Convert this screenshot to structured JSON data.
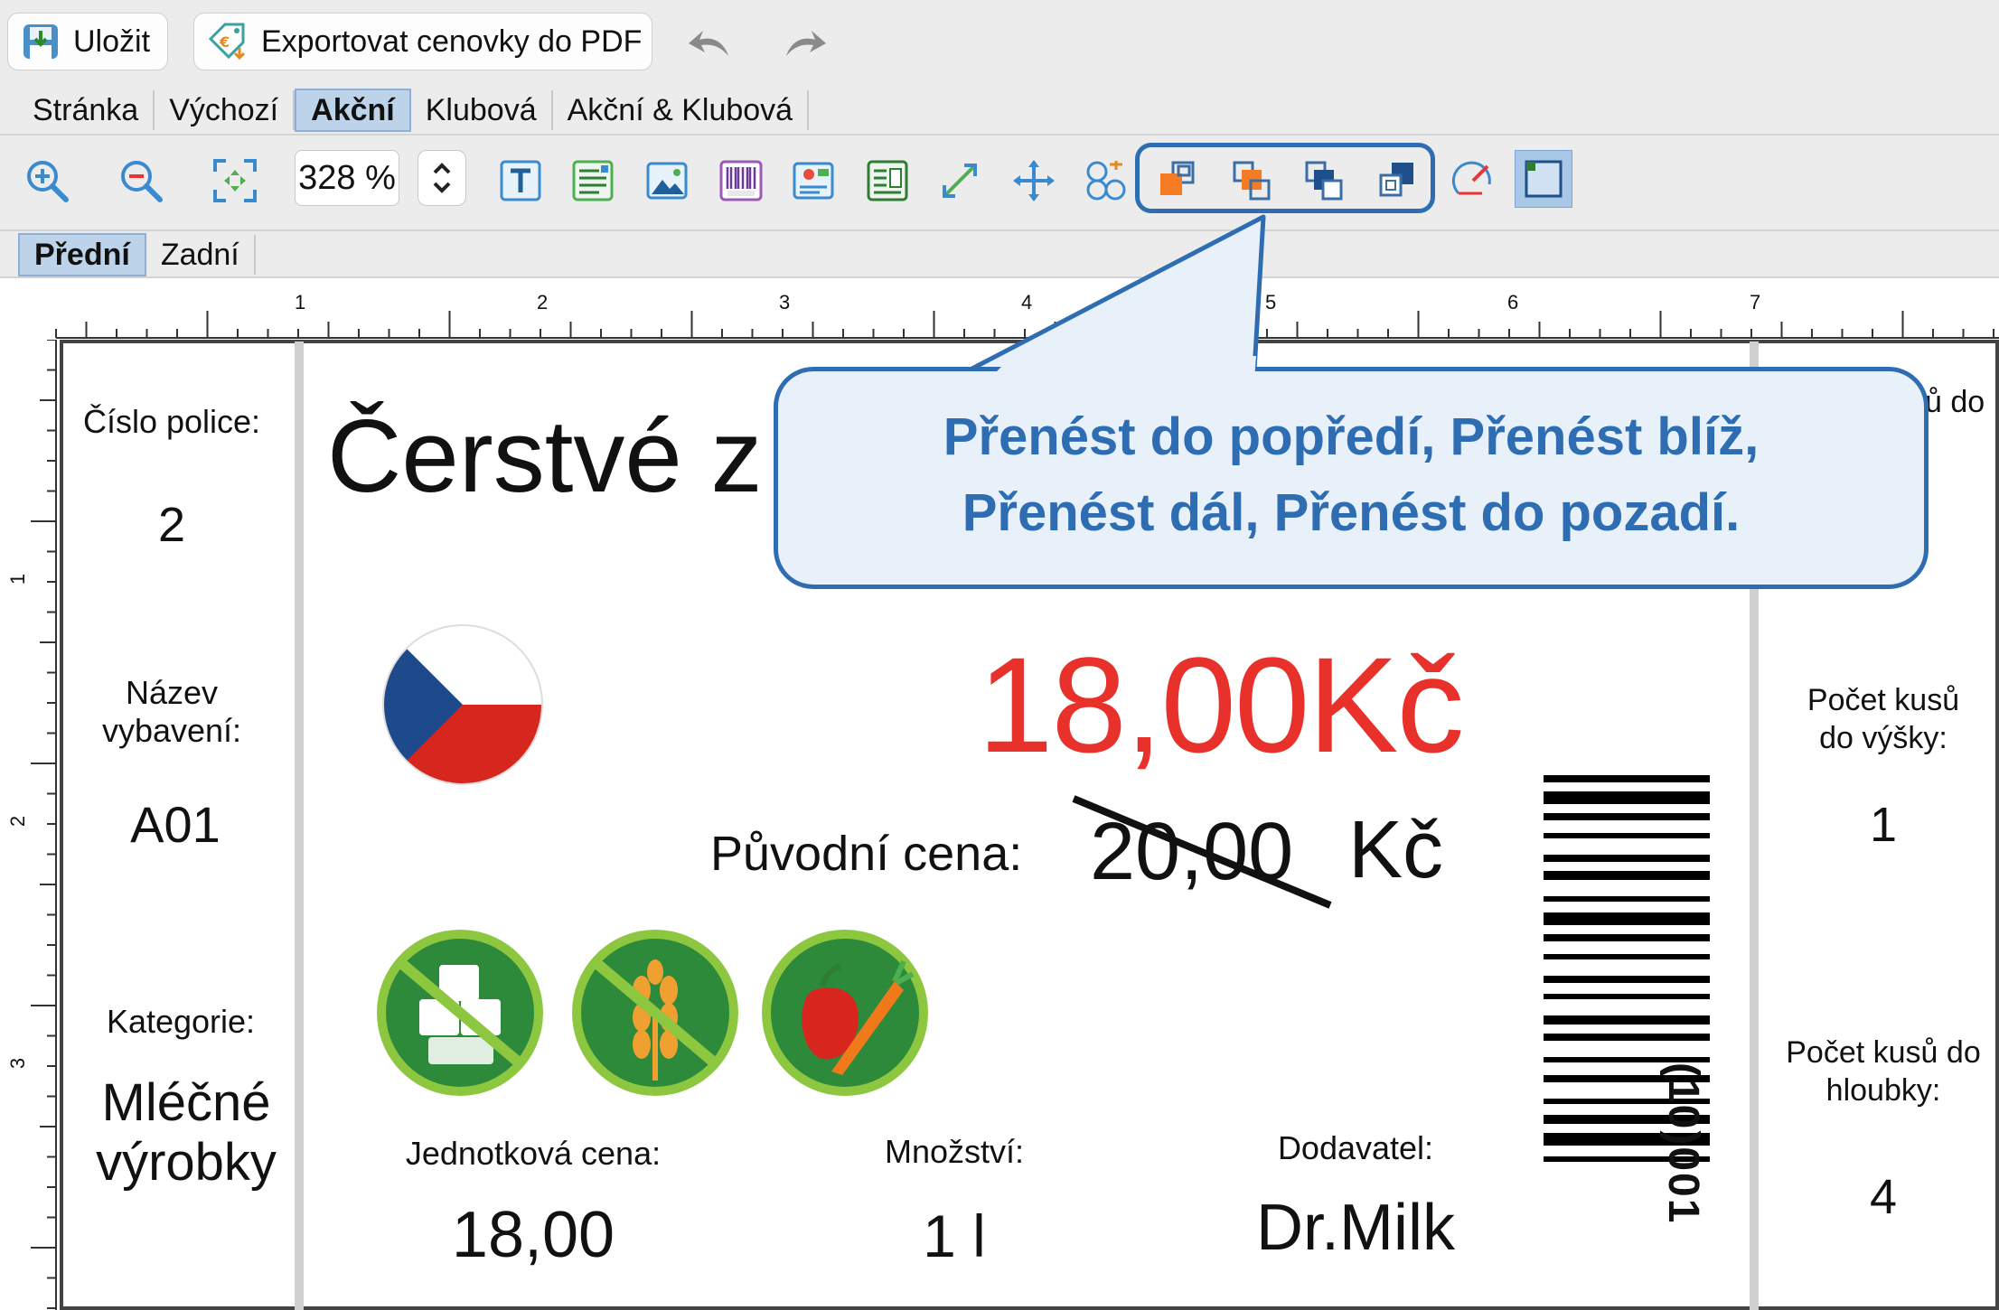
{
  "toolbar": {
    "save_label": "Uložit",
    "export_label": "Exportovat cenovky do PDF"
  },
  "tabs": [
    "Stránka",
    "Výchozí",
    "Akční",
    "Klubová",
    "Akční & Klubová"
  ],
  "active_tab": "Akční",
  "zoom": {
    "value": "328 %"
  },
  "side_tabs": [
    "Přední",
    "Zadní"
  ],
  "active_side_tab": "Přední",
  "ruler": {
    "top_ticks": [
      "1",
      "2",
      "3",
      "4",
      "5",
      "6",
      "7"
    ],
    "left_ticks": [
      "1",
      "2",
      "3"
    ]
  },
  "callout": {
    "line1": "Přenést do popředí, Přenést blíž,",
    "line2": "Přenést dál, Přenést do pozadí."
  },
  "price_tag": {
    "shelf_label": "Číslo police:",
    "shelf_value": "2",
    "equipment_label": "Název\nvybavení:",
    "equipment_value": "A01",
    "category_label": "Kategorie:",
    "category_value": "Mléčné\nvýrobky",
    "product_name_visible": "Čerstvé z",
    "price": "18,00Kč",
    "original_price_label": "Původní  cena:",
    "original_price_value": "20,00",
    "original_price_currency": "Kč",
    "unit_price_label": "Jednotková cena:",
    "unit_price_value": "18,00",
    "quantity_label": "Množství:",
    "quantity_value": "1 l",
    "supplier_label": "Dodavatel:",
    "supplier_value": "Dr.Milk",
    "barcode_text": "(10)001",
    "right_top_partial": "ů do",
    "height_count_label": "Počet kusů\ndo výšky:",
    "height_count_value": "1",
    "depth_count_label": "Počet kusů do\nhloubky:",
    "depth_count_value": "4"
  },
  "colors": {
    "price_red": "#e8312a",
    "callout_blue": "#2f6db3",
    "badge_green": "#2d8a3a"
  }
}
